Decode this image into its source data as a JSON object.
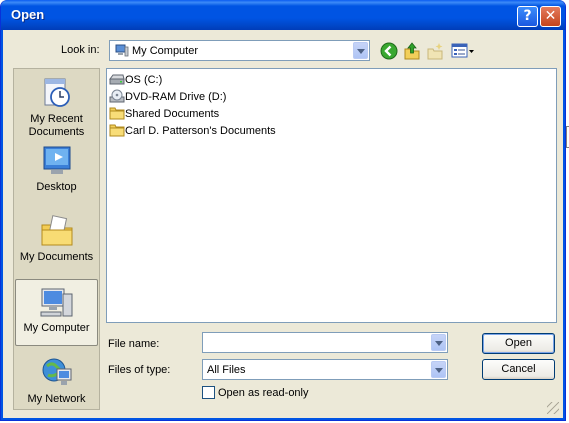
{
  "window": {
    "title": "Open"
  },
  "titlebar": {
    "help_glyph": "?",
    "close_glyph": "✕"
  },
  "lookin": {
    "label": "Look in:",
    "value": "My Computer"
  },
  "places": [
    {
      "label": "My Recent Documents",
      "icon": "recent-documents-icon"
    },
    {
      "label": "Desktop",
      "icon": "desktop-icon"
    },
    {
      "label": "My Documents",
      "icon": "my-documents-icon"
    },
    {
      "label": "My Computer",
      "icon": "my-computer-icon",
      "selected": true
    },
    {
      "label": "My Network",
      "icon": "my-network-icon"
    }
  ],
  "files": [
    {
      "name": "OS (C:)",
      "icon": "hard-drive-icon"
    },
    {
      "name": "DVD-RAM Drive (D:)",
      "icon": "dvd-drive-icon"
    },
    {
      "name": "Shared Documents",
      "icon": "folder-icon"
    },
    {
      "name": "Carl D. Patterson's Documents",
      "icon": "folder-icon"
    }
  ],
  "form": {
    "file_name_label": "File name:",
    "file_name_value": "",
    "files_of_type_label": "Files of type:",
    "files_of_type_value": "All Files",
    "open_button": "Open",
    "cancel_button": "Cancel",
    "readonly_label": "Open as read-only",
    "readonly_checked": false
  },
  "colors": {
    "title_blue": "#0054e3",
    "dialog_bg": "#ece9d8",
    "field_border": "#7f9db9"
  }
}
